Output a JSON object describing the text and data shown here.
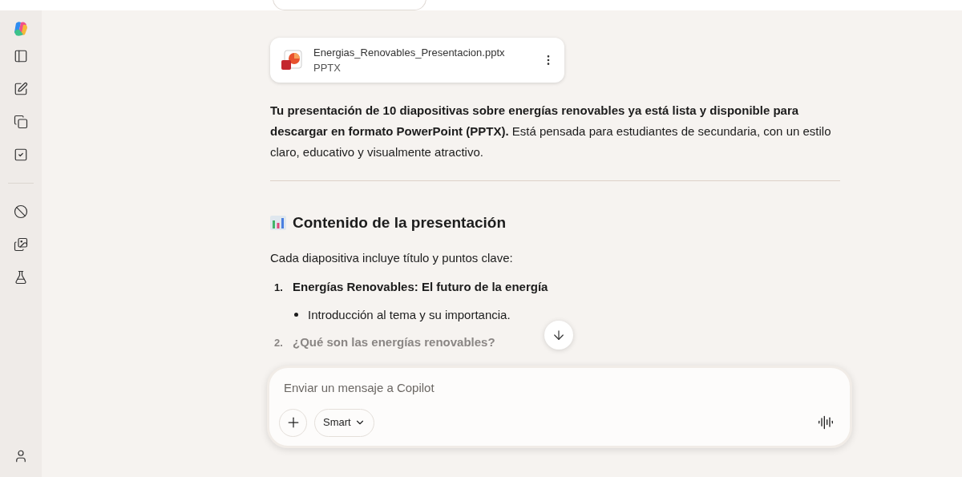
{
  "attachment": {
    "filename": "Energias_Renovables_Presentacion.pptx",
    "type": "PPTX"
  },
  "summary": "**Tu presentación de 10 diapositivas sobre energías renovables ya está lista y disponible para descargar en formato PowerPoint (PPTX).** Está pensada para estudiantes de secundaria, con un estilo claro, educativo y visualmente atractivo.",
  "heading": "Contenido de la presentación",
  "intro": "Cada diapositiva incluye título y puntos clave:",
  "slides": [
    {
      "number": "1.",
      "title": "Energías Renovables: El futuro de la energía",
      "faded": false,
      "points": [
        "Introducción al tema y su importancia."
      ]
    },
    {
      "number": "2.",
      "title": "¿Qué son las energías renovables?",
      "faded": true
    }
  ],
  "composer": {
    "placeholder": "Enviar un mensaje a Copilot",
    "mode": "Smart"
  }
}
